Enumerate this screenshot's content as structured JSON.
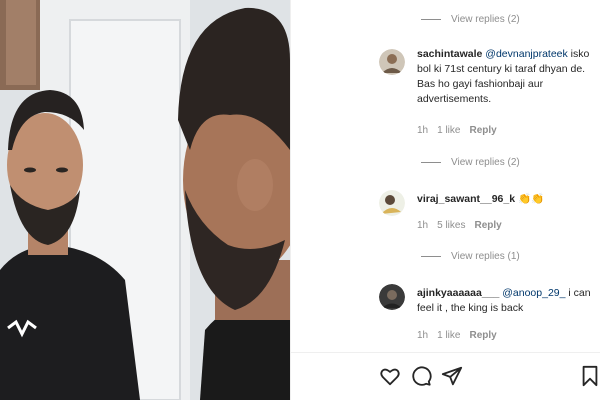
{
  "comments": [
    {
      "username": "sachintawale",
      "mention": "@devnanjprateek",
      "text": " isko bol ki 71st century ki taraf dhyan de. Bas ho gayi fashionbaji aur advertisements.",
      "time": "1h",
      "likes": "1 like",
      "reply_label": "Reply",
      "view_replies": "View replies (2)"
    },
    {
      "username": "viraj_sawant__96_k",
      "mention": "",
      "text": " 👏👏",
      "time": "1h",
      "likes": "5 likes",
      "reply_label": "Reply",
      "view_replies": "View replies (1)"
    },
    {
      "username": "ajinkyaaaaaa___",
      "mention": "@anoop_29_",
      "text": " i can feel it , the king is back",
      "time": "1h",
      "likes": "1 like",
      "reply_label": "Reply"
    }
  ],
  "top_view_replies": "View replies (2)",
  "actions": {
    "like_icon": "heart-icon",
    "comment_icon": "comment-icon",
    "share_icon": "share-icon",
    "save_icon": "bookmark-icon"
  },
  "colors": {
    "text": "#262626",
    "muted": "#8e8e8e",
    "mention": "#00376b"
  }
}
